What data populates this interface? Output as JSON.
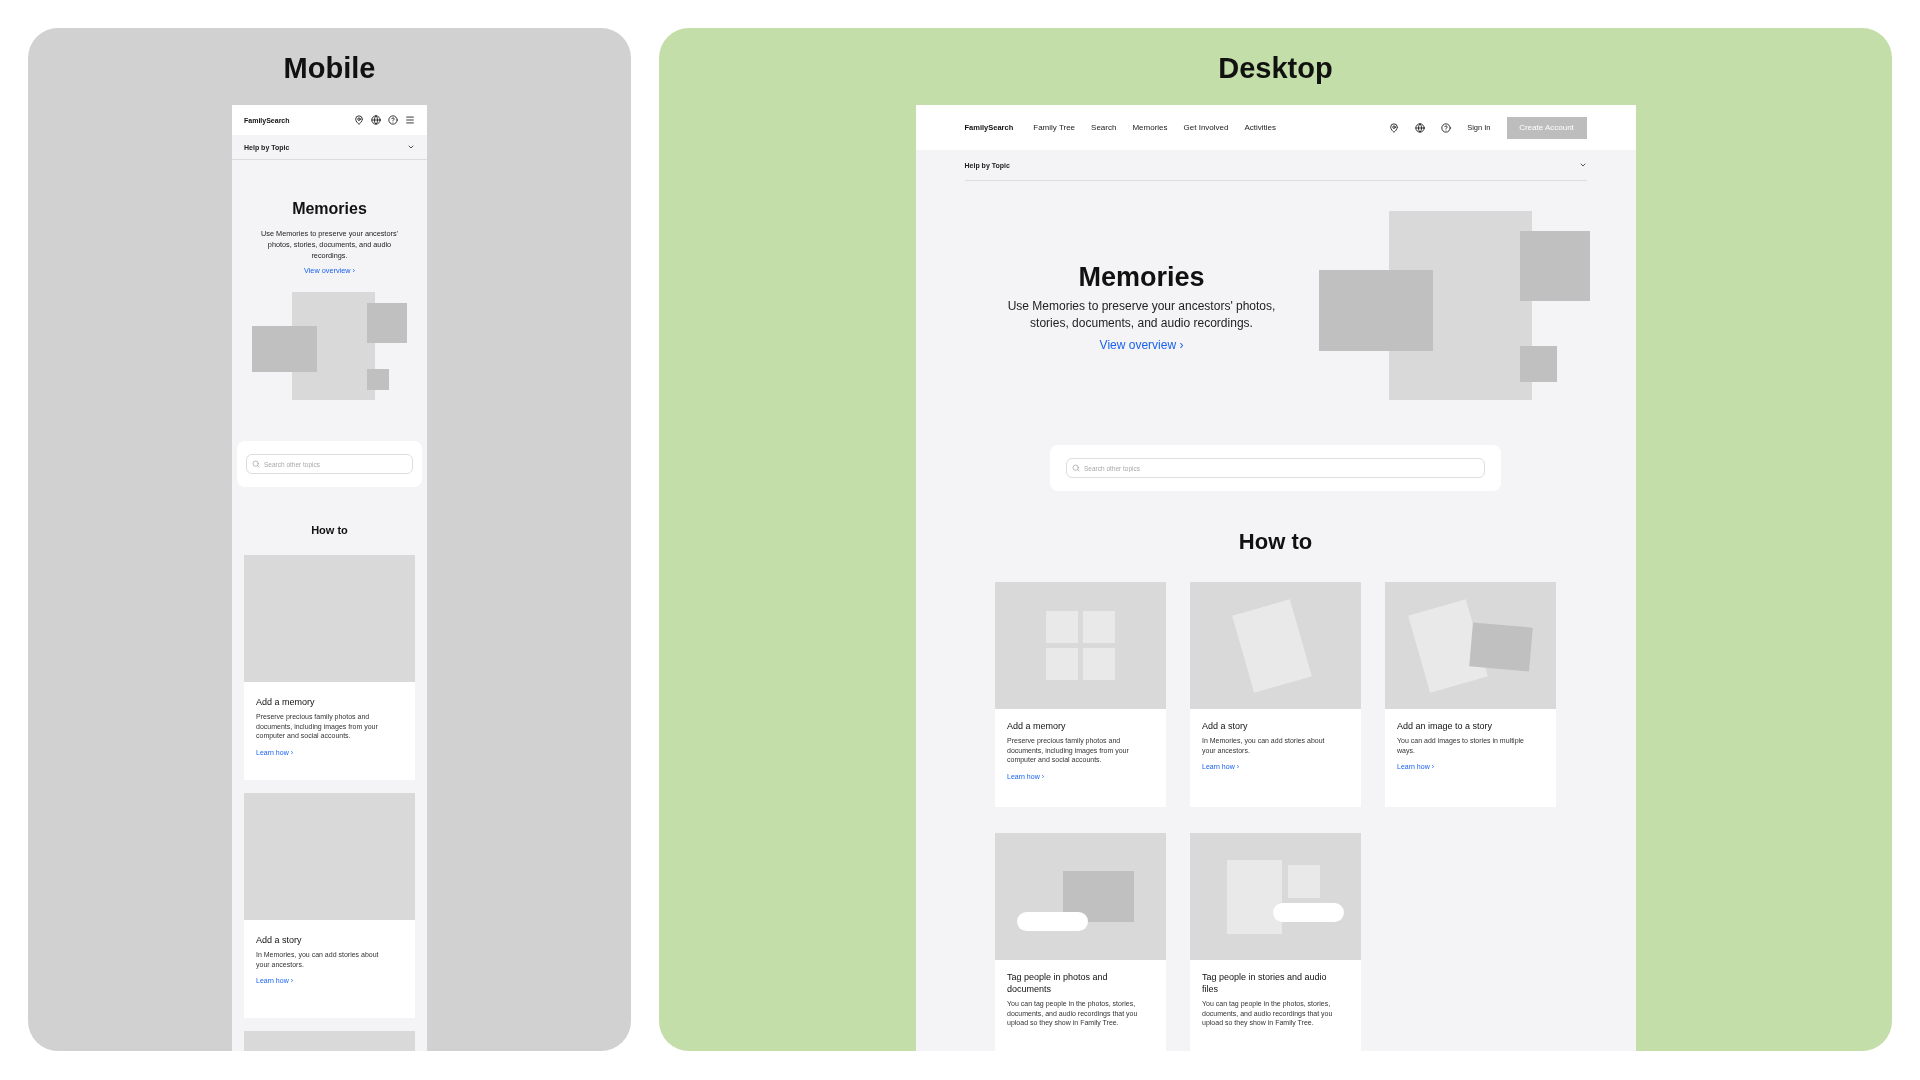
{
  "panels": [
    {
      "kind": "mobile",
      "title": "Mobile",
      "page": {
        "header": {
          "logo": "FamilySearch"
        },
        "topic_bar": {
          "label": "Help by Topic"
        },
        "hero": {
          "title": "Memories",
          "description": "Use Memories to preserve your ancestors' photos, stories, documents, and audio recordings.",
          "link": "View overview ›"
        },
        "search": {
          "placeholder": "Search other topics"
        },
        "howto": {
          "title": "How to",
          "cards": [
            {
              "kind": "blank",
              "title": "Add a memory",
              "description": "Preserve precious family photos and documents, including images from your computer and social accounts.",
              "link": "Learn how ›"
            },
            {
              "kind": "blank",
              "title": "Add a story",
              "description": "In Memories, you can add stories about your ancestors.",
              "link": "Learn how ›"
            },
            {
              "kind": "blank"
            }
          ]
        }
      }
    },
    {
      "kind": "desktop",
      "title": "Desktop",
      "page": {
        "header": {
          "logo": "FamilySearch",
          "nav": [
            "Family Tree",
            "Search",
            "Memories",
            "Get Involved",
            "Activities"
          ],
          "sign_in": "Sign In",
          "create_account": {
            "label": "Create Account",
            "disabled": true
          }
        },
        "topic_bar": {
          "label": "Help by Topic"
        },
        "hero": {
          "title": "Memories",
          "description": "Use Memories to preserve your ancestors' photos, stories, documents, and audio recordings.",
          "link": "View overview ›"
        },
        "search": {
          "placeholder": "Search other topics"
        },
        "howto": {
          "title": "How to",
          "cards": [
            {
              "kind": "grid",
              "title": "Add a memory",
              "description": "Preserve precious family photos and documents, including images from your computer and social accounts.",
              "link": "Learn how ›"
            },
            {
              "kind": "page",
              "title": "Add a story",
              "description": "In Memories, you can add stories about your ancestors.",
              "link": "Learn how ›"
            },
            {
              "kind": "page-image",
              "title": "Add an image to a story",
              "description": "You can add images to stories in multiple ways.",
              "link": "Learn how ›"
            },
            {
              "kind": "tag-photo",
              "title": "Tag people in photos and documents",
              "description": "You can tag people in the photos, stories, documents, and audio recordings that you upload so they show in Family Tree."
            },
            {
              "kind": "tag-story",
              "title": "Tag people in stories and audio files",
              "description": "You can tag people in the photos, stories, documents, and audio recordings that you upload so they show in Family Tree."
            }
          ]
        }
      }
    }
  ]
}
